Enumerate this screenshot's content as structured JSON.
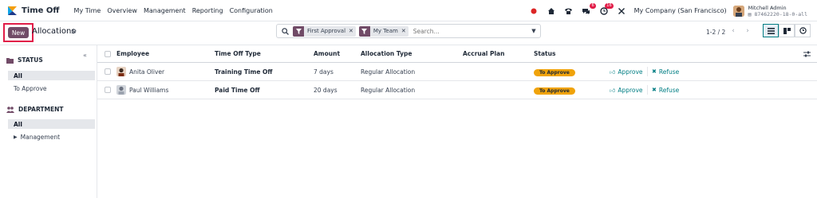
{
  "app": {
    "name": "Time Off",
    "menu": [
      "My Time",
      "Overview",
      "Management",
      "Reporting",
      "Configuration"
    ]
  },
  "systray": {
    "messages_badge": "6",
    "activities_badge": "16",
    "company": "My Company (San Francisco)",
    "user_name": "Mitchell Admin",
    "database": "87462220-18-0-all"
  },
  "control": {
    "new_label": "New",
    "title": "Allocations",
    "facets": [
      "First Approval",
      "My Team"
    ],
    "search_placeholder": "Search...",
    "pager": "1-2 / 2"
  },
  "sidebar": {
    "status_heading": "STATUS",
    "status_items": [
      "All",
      "To Approve"
    ],
    "department_heading": "DEPARTMENT",
    "department_items": [
      "All",
      "Management"
    ]
  },
  "table": {
    "headers": [
      "Employee",
      "Time Off Type",
      "Amount",
      "Allocation Type",
      "Accrual Plan",
      "Status"
    ],
    "rows": [
      {
        "employee": "Anita Oliver",
        "type": "Training Time Off",
        "amount": "7 days",
        "allocation_type": "Regular Allocation",
        "accrual_plan": "",
        "status": "To Approve",
        "approve": "Approve",
        "refuse": "Refuse"
      },
      {
        "employee": "Paul Williams",
        "type": "Paid Time Off",
        "amount": "20 days",
        "allocation_type": "Regular Allocation",
        "accrual_plan": "",
        "status": "To Approve",
        "approve": "Approve",
        "refuse": "Refuse"
      }
    ]
  },
  "colors": {
    "brand": "#714b67",
    "accent": "#017e84",
    "status_warning": "#f0a30a",
    "highlight_border": "#e11d48"
  }
}
